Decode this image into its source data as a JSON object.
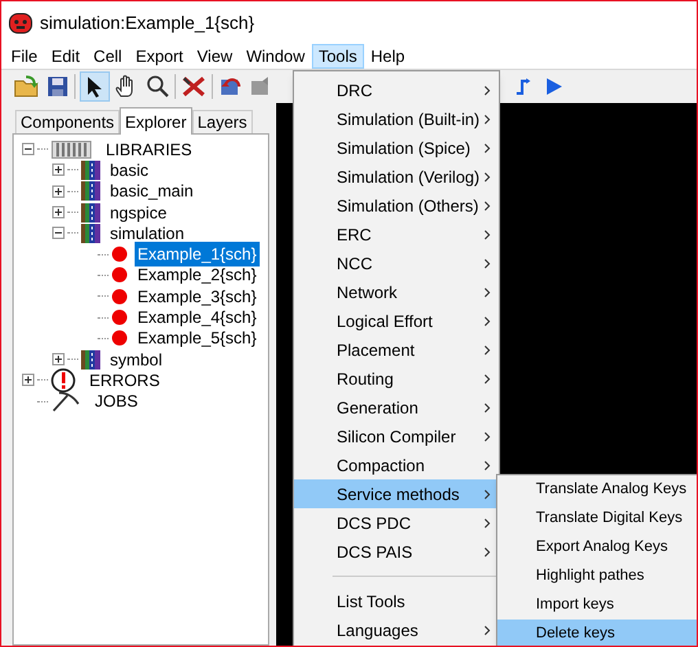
{
  "window": {
    "title": "simulation:Example_1{sch}"
  },
  "menu_bar": [
    {
      "label": "File",
      "selected": false
    },
    {
      "label": "Edit",
      "selected": false
    },
    {
      "label": "Cell",
      "selected": false
    },
    {
      "label": "Export",
      "selected": false
    },
    {
      "label": "View",
      "selected": false
    },
    {
      "label": "Window",
      "selected": false
    },
    {
      "label": "Tools",
      "selected": true
    },
    {
      "label": "Help",
      "selected": false
    }
  ],
  "tabs": [
    {
      "label": "Components",
      "selected": false
    },
    {
      "label": "Explorer",
      "selected": true
    },
    {
      "label": "Layers",
      "selected": false
    }
  ],
  "tree": [
    {
      "kind": "root",
      "label": "LIBRARIES",
      "expanded": true,
      "children": [
        {
          "kind": "library",
          "label": "basic",
          "expanded": false
        },
        {
          "kind": "library",
          "label": "basic_main",
          "expanded": false
        },
        {
          "kind": "library",
          "label": "ngspice",
          "expanded": false
        },
        {
          "kind": "library",
          "label": "simulation",
          "expanded": true,
          "children": [
            {
              "kind": "cell",
              "label": "Example_1{sch}",
              "selected": true
            },
            {
              "kind": "cell",
              "label": "Example_2{sch}",
              "selected": false
            },
            {
              "kind": "cell",
              "label": "Example_3{sch}",
              "selected": false
            },
            {
              "kind": "cell",
              "label": "Example_4{sch}",
              "selected": false
            },
            {
              "kind": "cell",
              "label": "Example_5{sch}",
              "selected": false
            }
          ]
        },
        {
          "kind": "library",
          "label": "symbol",
          "expanded": false
        }
      ]
    },
    {
      "kind": "errors",
      "label": "ERRORS",
      "expanded": false
    },
    {
      "kind": "jobs",
      "label": "JOBS"
    }
  ],
  "tools_menu": {
    "groups": [
      [
        {
          "label": "DRC",
          "submenu": true,
          "selected": false
        },
        {
          "label": "Simulation (Built-in)",
          "submenu": true,
          "selected": false
        },
        {
          "label": "Simulation (Spice)",
          "submenu": true,
          "selected": false
        },
        {
          "label": "Simulation (Verilog)",
          "submenu": true,
          "selected": false
        },
        {
          "label": "Simulation (Others)",
          "submenu": true,
          "selected": false
        },
        {
          "label": "ERC",
          "submenu": true,
          "selected": false
        },
        {
          "label": "NCC",
          "submenu": true,
          "selected": false
        },
        {
          "label": "Network",
          "submenu": true,
          "selected": false
        },
        {
          "label": "Logical Effort",
          "submenu": true,
          "selected": false
        },
        {
          "label": "Placement",
          "submenu": true,
          "selected": false
        },
        {
          "label": "Routing",
          "submenu": true,
          "selected": false
        },
        {
          "label": "Generation",
          "submenu": true,
          "selected": false
        },
        {
          "label": "Silicon Compiler",
          "submenu": true,
          "selected": false
        },
        {
          "label": "Compaction",
          "submenu": true,
          "selected": false
        },
        {
          "label": "Service methods",
          "submenu": true,
          "selected": true
        },
        {
          "label": "DCS PDC",
          "submenu": true,
          "selected": false
        },
        {
          "label": "DCS PAIS",
          "submenu": true,
          "selected": false
        }
      ],
      [
        {
          "label": "List Tools",
          "submenu": false,
          "selected": false
        },
        {
          "label": "Languages",
          "submenu": true,
          "selected": false
        }
      ]
    ]
  },
  "submenu": [
    {
      "label": "Translate Analog Keys",
      "selected": false
    },
    {
      "label": "Translate Digital Keys",
      "selected": false
    },
    {
      "label": "Export Analog Keys",
      "selected": false
    },
    {
      "label": "Highlight pathes",
      "selected": false
    },
    {
      "label": "Import keys",
      "selected": false
    },
    {
      "label": "Delete keys",
      "selected": true
    }
  ]
}
